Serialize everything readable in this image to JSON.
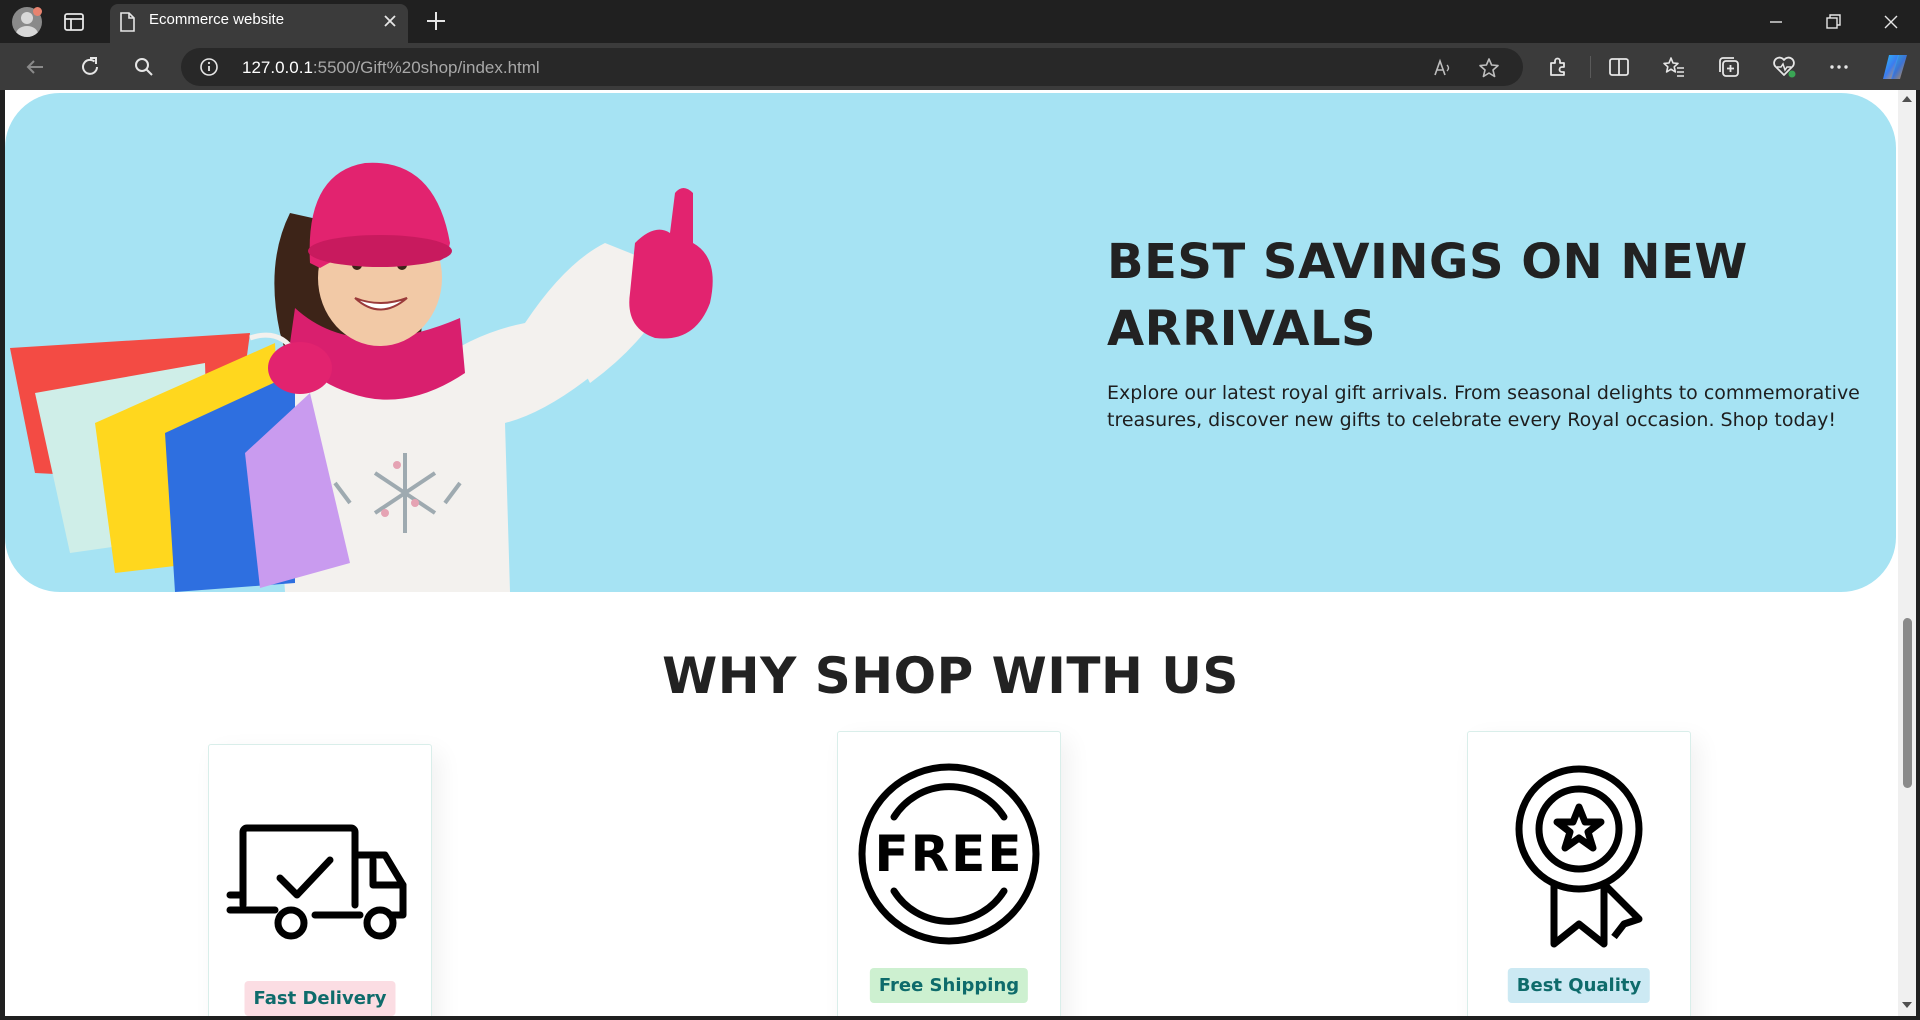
{
  "browser": {
    "tab_title": "Ecommerce website",
    "url_host": "127.0.0.1",
    "url_rest": ":5500/Gift%20shop/index.html"
  },
  "hero": {
    "title": "BEST SAVINGS ON NEW ARRIVALS",
    "text": "Explore our latest royal gift arrivals. From seasonal delights to commemorative treasures, discover new gifts to celebrate every Royal occasion. Shop today!",
    "background_color": "#a6e3f3"
  },
  "why": {
    "title": "WHY SHOP WITH US",
    "features": [
      {
        "label": "Fast Delivery",
        "icon": "delivery-truck-icon",
        "badge_color": "#fbdde3"
      },
      {
        "label": "Free Shipping",
        "icon": "free-circle-icon",
        "badge_color": "#cdf0d0"
      },
      {
        "label": "Best Quality",
        "icon": "quality-award-icon",
        "badge_color": "#cce9f3"
      }
    ]
  },
  "colors": {
    "text_dark": "#222222",
    "badge_text": "#0e6b6b"
  }
}
